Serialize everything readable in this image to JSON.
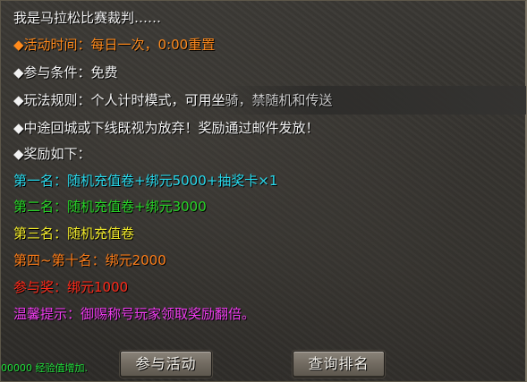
{
  "dialog": {
    "greeting": "我是马拉松比赛裁判……",
    "activity_time": "◆活动时间：每日一次，0:00重置",
    "conditions": "◆参与条件：免费",
    "rules_main": "◆玩法规则：个人计时模式，可用坐",
    "rules_tail": "骑，禁随机和传送",
    "penalty": "◆中途回城或下线既视为放弃！奖励通过邮件发放！",
    "rewards_header": "◆奖励如下：",
    "reward_1": "第一名：随机充值卷+绑元5000+抽奖卡×1",
    "reward_2": "第二名：随机充值卷+绑元3000",
    "reward_3": "第三名：随机充值卷",
    "reward_4_10": "第四~第十名：绑元2000",
    "reward_participation": "参与奖：绑元1000",
    "tip": "温馨提示：御赐称号玩家领取奖励翻倍。"
  },
  "buttons": {
    "join": "参与活动",
    "query_rank": "查询排名"
  },
  "system_message": "00000 经验值增加.",
  "colors": {
    "time_line": "#ff8a1c",
    "reward_1": "#28d9ec",
    "reward_2": "#27d427",
    "reward_3": "#f1ea2a",
    "reward_4_10": "#ff7f1a",
    "reward_participation": "#ff2a1a",
    "tip": "#f03cf0",
    "system_message": "#1fe03a"
  }
}
